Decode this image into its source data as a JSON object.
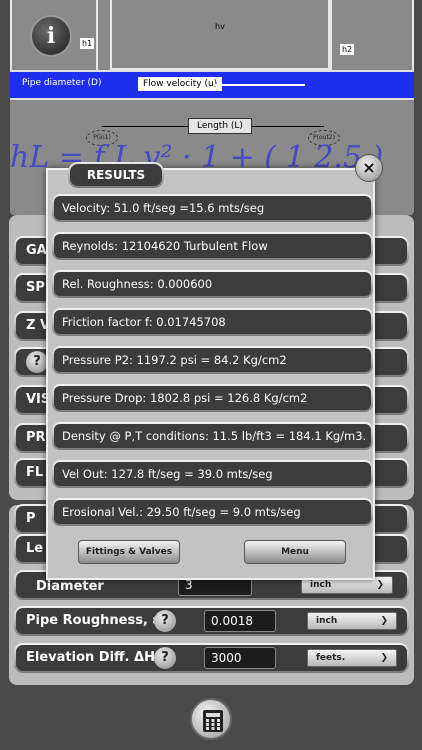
{
  "diagram": {
    "h1_label": "h1",
    "hv_label": "hv",
    "h2_label": "h2",
    "pipe_diameter_label": "Pipe diameter (D)",
    "flow_velocity_label": "Flow velocity (u)",
    "length_label": "Length (L)",
    "p_in_label": "P(in1)",
    "p_out_label": "P(out2)",
    "formula_text": "hL = f L v² · 1  + ( 1   2.5 )"
  },
  "info_button_label": "i",
  "results_modal": {
    "title": "RESULTS",
    "close_label": "×",
    "rows": [
      "Velocity: 51.0 ft/seg =15.6 mts/seg",
      "Reynolds: 12104620   Turbulent Flow",
      "Rel. Roughness: 0.000600",
      "Friction factor f: 0.01745708",
      "Pressure P2: 1197.2 psi = 84.2 Kg/cm2",
      "Pressure Drop: 1802.8 psi = 126.8 Kg/cm2",
      "Density @ P,T conditions: 11.5 lb/ft3 = 184.1 Kg/m3.",
      "Vel Out: 127.8 ft/seg = 39.0 mts/seg",
      "Erosional Vel.: 29.50 ft/seg = 9.0 mts/seg"
    ],
    "fittings_button": "Fittings & Valves",
    "menu_button": "Menu"
  },
  "background_rows": {
    "r1": "GA",
    "r2": "SPE",
    "r3": "Z Va",
    "r4": "?",
    "r5": "VIS",
    "r6": "PR",
    "r7": "FL",
    "section2_header": "P",
    "length_row": "Le"
  },
  "input_rows": [
    {
      "label": "Diameter",
      "value": "3",
      "unit": "inch",
      "help": ""
    },
    {
      "label": "Pipe Roughness, ε",
      "value": "0.0018",
      "unit": "inch",
      "help": "?"
    },
    {
      "label": "Elevation Diff.  ΔH",
      "value": "3000",
      "unit": "feets.",
      "help": "?"
    }
  ],
  "chevron": "❯"
}
